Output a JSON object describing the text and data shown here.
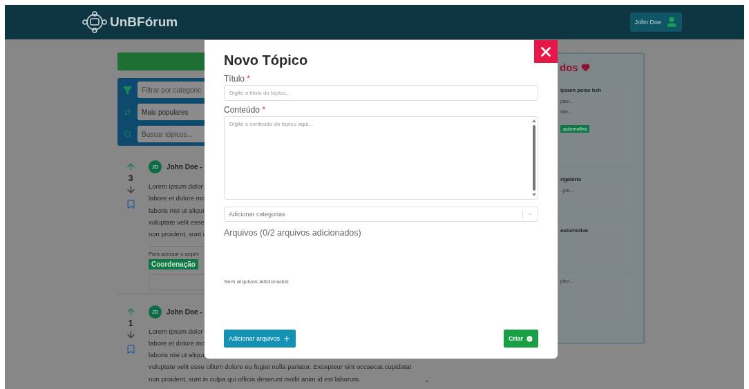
{
  "header": {
    "logo": "UnBFórum",
    "user_button": "John Doe"
  },
  "toolbar": {
    "filter": {
      "placeholder": "Filtrar por categoric"
    },
    "sort": {
      "value": "Mais populares"
    },
    "search": {
      "placeholder": "Buscar tópicos..."
    }
  },
  "posts": [
    {
      "avatar": "JD",
      "author": "John Doe -",
      "votes": "3",
      "lines": [
        "Lorem ipsum dolor",
        "labore et dolore mc",
        "laboris nisi ut aliqui",
        "voluptate velit esse",
        "non proident, sunt i"
      ],
      "note": "Para acessar o arquiv",
      "tag": "Coordenação"
    },
    {
      "avatar": "JD",
      "author": "John Doe -",
      "votes": "1",
      "lines": [
        "Lorem ipsum dolor",
        "labore et dolore mc",
        "laboris nisi ut aliqui",
        "voluptate velit esse cillum dolore eu fugiat nulla pariatur. Excepteur sint occaecat cupidatat",
        "non proident, sunt in culpa qui officia deserunt mollit anim id est laborum."
      ]
    }
  ],
  "sidebar": {
    "title": "dos",
    "cards": [
      {
        "title": "ipsum poise heh",
        "lines": [
          "pisci...",
          "tate..."
        ],
        "tag": "automotiva"
      },
      {
        "title": "rigatório",
        "lines": [
          "- pre..."
        ]
      },
      {
        "title": "automotiva"
      },
      {
        "lines": [
          "pisci..."
        ]
      }
    ]
  },
  "modal": {
    "title": "Novo Tópico",
    "fields": [
      {
        "kind": "input",
        "label": "Título",
        "required_mark": "*",
        "placeholder": "Digite o título do tópico..."
      },
      {
        "kind": "textarea",
        "label": "Conteúdo",
        "required_mark": "*",
        "placeholder": "Digite o conteúdo do tópico aqui..."
      }
    ],
    "category_select": {
      "placeholder": "Adicionar categorias"
    },
    "files_heading": "Arquivos (0/2 arquivos adicionados)",
    "empty_text": "Sem arquivos adicionados",
    "add_files_button": "Adicionar arquivos",
    "create_button": "Criar"
  }
}
